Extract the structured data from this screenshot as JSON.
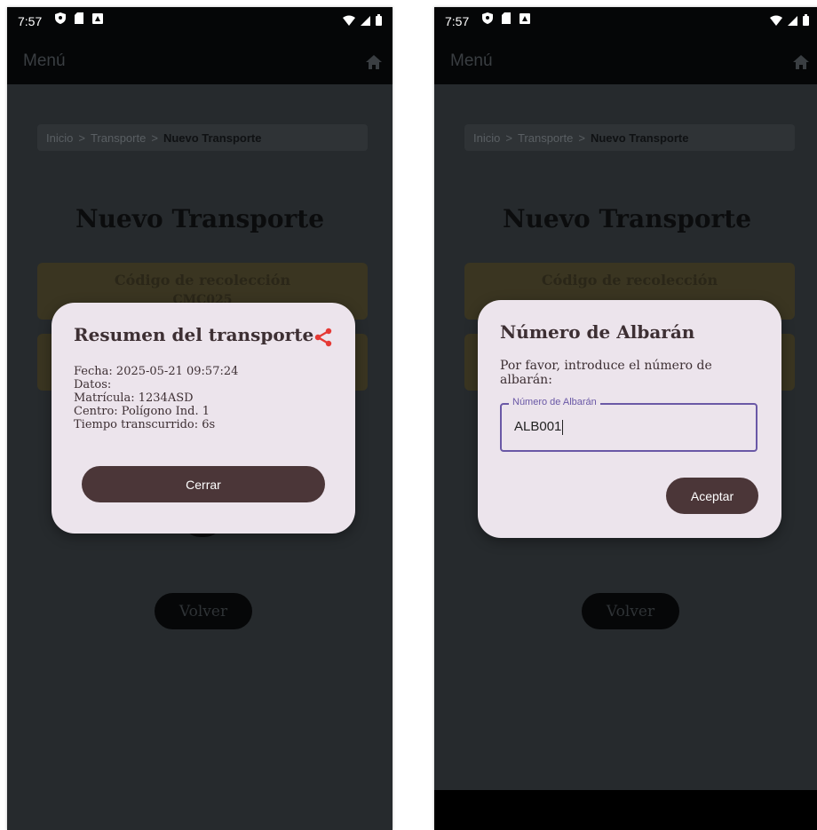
{
  "left": {
    "status": {
      "time": "7:57"
    },
    "appbar": {
      "menu": "Menú"
    },
    "breadcrumb": {
      "inicio": "Inicio",
      "sep1": ">",
      "transporte": "Transporte",
      "sep2": ">",
      "current": "Nuevo Transporte"
    },
    "page_title": "Nuevo Transporte",
    "card1": {
      "title": "Código de recolección",
      "value": "CMC025"
    },
    "volver": "Volver",
    "summary_dialog": {
      "title": "Resumen del transporte",
      "lines": [
        "Fecha: 2025-05-21 09:57:24",
        "Datos:",
        "Matrícula: 1234ASD",
        "Centro: Polígono Ind. 1",
        "Tiempo transcurrido: 6s"
      ],
      "close_label": "Cerrar"
    }
  },
  "right": {
    "status": {
      "time": "7:57"
    },
    "appbar": {
      "menu": "Menú"
    },
    "breadcrumb": {
      "inicio": "Inicio",
      "sep1": ">",
      "transporte": "Transporte",
      "sep2": ">",
      "current": "Nuevo Transporte"
    },
    "page_title": "Nuevo Transporte",
    "card1": {
      "title": "Código de recolección"
    },
    "volver": "Volver",
    "albaran_dialog": {
      "title": "Número de Albarán",
      "description": "Por favor, introduce el número de albarán:",
      "field_label": "Número de Albarán",
      "field_value": "ALB001",
      "accept_label": "Aceptar"
    }
  },
  "colors": {
    "accent": "#e53935",
    "button": "#4b3638",
    "dialog_bg": "#ece4ec",
    "field_border": "#6a58a6"
  },
  "icons": [
    "shield-icon",
    "sim-icon",
    "app-icon",
    "wifi-icon",
    "signal-icon",
    "battery-icon",
    "home-icon",
    "share-icon"
  ]
}
